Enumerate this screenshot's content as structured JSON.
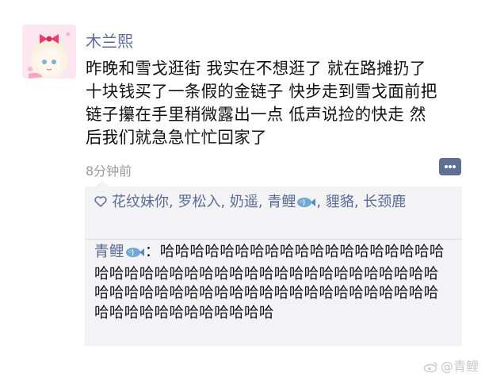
{
  "post": {
    "username": "木兰熙",
    "text": "昨晚和雪戈逛街 我实在不想逛了 就在路摊扔了十块钱买了一条假的金链子 快步走到雪戈面前把链子攥在手里稍微露出一点 低声说捡的快走 然后我们就急急忙忙回家了",
    "timestamp": "8分钟前"
  },
  "likes": {
    "names": [
      "花纹妹你",
      "罗松入",
      "奶遥",
      "青鲤",
      "貍貉",
      "长颈鹿"
    ],
    "name_suffix_icon": [
      "",
      "",
      "",
      "fish-icon",
      "",
      ""
    ]
  },
  "comments": [
    {
      "author": "青鲤",
      "author_icon": "fish-icon",
      "text": "哈哈哈哈哈哈哈哈哈哈哈哈哈哈哈哈哈哈哈哈哈哈哈哈哈哈哈哈哈哈哈哈哈哈哈哈哈哈哈哈哈哈哈哈哈哈哈哈哈哈哈哈哈哈哈哈哈哈哈哈哈哈哈哈哈哈哈哈哈哈哈哈哈哈哈哈哈"
    }
  ],
  "watermark": "@青鲤",
  "colors": {
    "name_link": "#5a6b94",
    "feedback_bg": "#f3f3f5",
    "comment_button": "#5f6f91"
  }
}
